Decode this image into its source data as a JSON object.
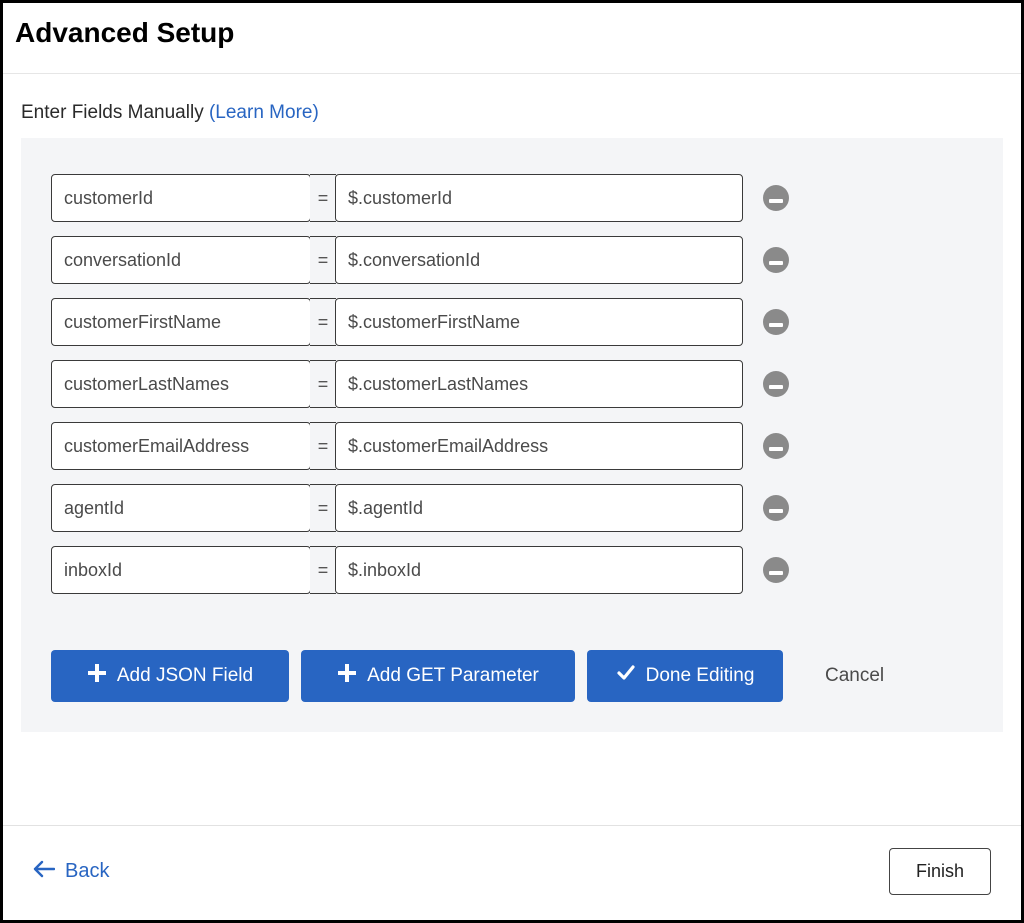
{
  "title": "Advanced Setup",
  "labelRow": {
    "text": "Enter Fields Manually ",
    "link": "(Learn More)"
  },
  "equalsGlyph": "=",
  "fields": [
    {
      "key": "customerId",
      "value": "$.customerId"
    },
    {
      "key": "conversationId",
      "value": "$.conversationId"
    },
    {
      "key": "customerFirstName",
      "value": "$.customerFirstName"
    },
    {
      "key": "customerLastNames",
      "value": "$.customerLastNames"
    },
    {
      "key": "customerEmailAddress",
      "value": "$.customerEmailAddress"
    },
    {
      "key": "agentId",
      "value": "$.agentId"
    },
    {
      "key": "inboxId",
      "value": "$.inboxId"
    }
  ],
  "buttons": {
    "addJson": "Add JSON Field",
    "addGet": "Add GET Parameter",
    "doneEditing": "Done Editing",
    "cancel": "Cancel"
  },
  "footer": {
    "back": "Back",
    "finish": "Finish"
  }
}
